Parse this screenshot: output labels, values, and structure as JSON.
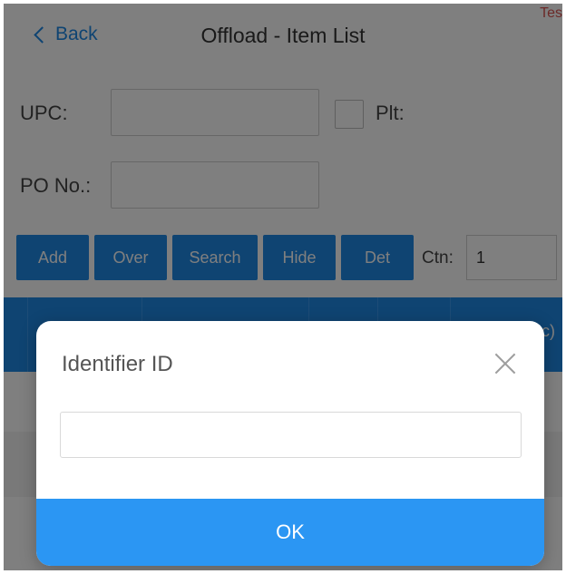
{
  "header": {
    "back_label": "Back",
    "title": "Offload - Item List",
    "env_tag": "Tes"
  },
  "form": {
    "upc_label": "UPC:",
    "upc_value": "",
    "plt_label": "Plt:",
    "po_label": "PO No.:",
    "po_value": ""
  },
  "actions": {
    "add": "Add",
    "over": "Over",
    "search": "Search",
    "hide": "Hide",
    "det": "Det",
    "ctn_label": "Ctn:",
    "ctn_value": "1"
  },
  "table": {
    "header_tail_text": "c)"
  },
  "modal": {
    "title": "Identifier ID",
    "input_value": "",
    "ok_label": "OK"
  },
  "colors": {
    "accent": "#1e88e5",
    "ok_button": "#2b96f3",
    "env_tag": "#d9534f"
  },
  "icons": [
    "chevron-left-icon",
    "close-icon"
  ]
}
